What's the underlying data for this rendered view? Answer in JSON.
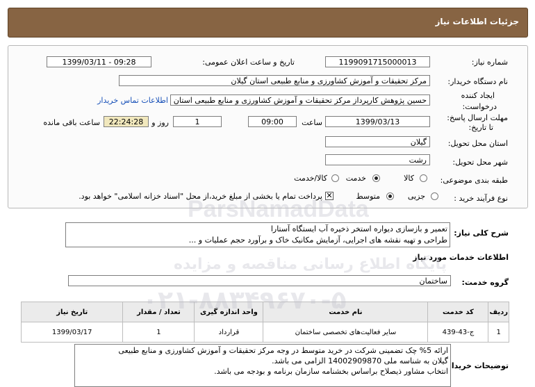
{
  "header": {
    "title": "جزئیات اطلاعات نیاز"
  },
  "form": {
    "need_number_label": "شماره نیاز:",
    "need_number": "1199091715000013",
    "announce_label": "تاریخ و ساعت اعلان عمومی:",
    "announce_value": "1399/03/11 - 09:28",
    "buyer_org_label": "نام دستگاه خریدار:",
    "buyer_org": "مرکز تحقیقات و آموزش کشاورزی و منابع طبیعی استان گیلان",
    "creator_label_1": "ایجاد کننده",
    "creator_label_2": "درخواست:",
    "creator": "حسین پژوهش کارپرداز مرکز تحقیقات و آموزش کشاورزی و منابع طبیعی استان",
    "contact_link": "اطلاعات تماس خریدار",
    "deadline_label_1": "مهلت ارسال پاسخ:",
    "deadline_label_2": "تا تاریخ:",
    "deadline_date": "1399/03/13",
    "time_label": "ساعت",
    "deadline_time": "09:00",
    "days_value": "1",
    "days_label": "روز و",
    "remaining_time": "22:24:28",
    "remaining_label": "ساعت باقی مانده",
    "province_label": "استان محل تحویل:",
    "province": "گیلان",
    "city_label": "شهر محل تحویل:",
    "city": "رشت",
    "category_label": "طبقه بندی موضوعی:",
    "category_options": [
      "کالا",
      "خدمت",
      "کالا/خدمت"
    ],
    "category_selected": "خدمت",
    "process_label": "نوع فرآیند خرید :",
    "process_options": [
      "جزیی",
      "متوسط"
    ],
    "process_selected": "متوسط",
    "payment_note": "پرداخت تمام یا بخشی از مبلغ خرید،از محل \"اسناد خزانه اسلامی\" خواهد بود."
  },
  "summary": {
    "label": "شرح کلی نیاز:",
    "line1": "تعمیر و بازسازی دیواره استخر ذخیره آب ایستگاه آستارا",
    "line2": "طراحی و تهیه نقشه های اجرایی، آزمایش مکانیک خاک و برآورد حجم عملیات و ..."
  },
  "services": {
    "section_title": "اطلاعات خدمات مورد نیاز",
    "group_label": "گروه خدمت:",
    "group_value": "ساختمان",
    "columns": [
      "ردیف",
      "کد خدمت",
      "نام خدمت",
      "واحد اندازه گیری",
      "تعداد / مقدار",
      "تاریخ نیاز"
    ],
    "rows": [
      [
        "1",
        "ج-43-439",
        "سایر فعالیت‌های تخصصی ساختمان",
        "قرارداد",
        "1",
        "1399/03/17"
      ]
    ]
  },
  "buyer_notes": {
    "label": "توضیحات خریدار:",
    "line1": "ارائه 5% چک تضمینی شرکت در خرید متوسط در وجه مرکز تحقیقات و آموزش کشاورزی و منابع طبیعی",
    "line2": "گیلان به شناسه ملی 14002909870 الزامی می باشد.",
    "line3": "انتخاب مشاور ذیصلاح براساس بخشنامه سازمان برنامه و بودجه می باشد."
  },
  "watermark": {
    "line1": "ParsNamadData",
    "line2": "پایگاه اطلاع رسانی مناقصه و مزایده",
    "line3": "۰۲۱-۸۸۳۴۹۶۷۰-۵"
  }
}
